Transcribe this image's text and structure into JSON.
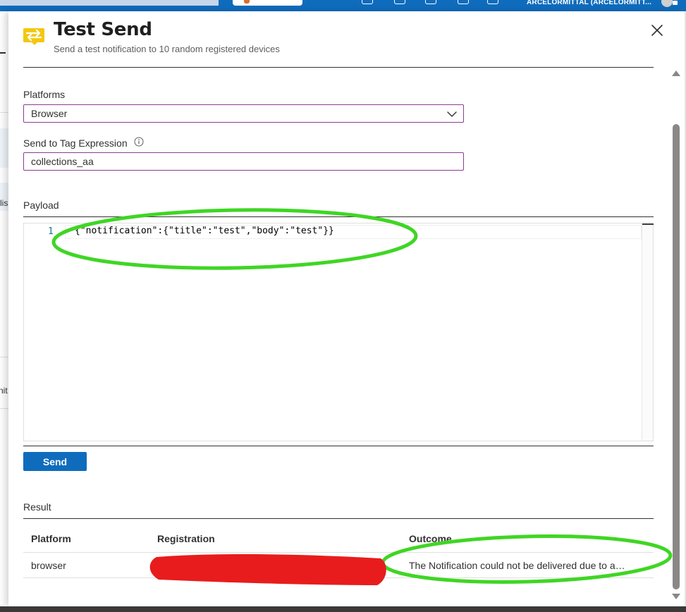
{
  "topbar": {
    "account": "ARCELORMITTAL (ARCELORMITT..."
  },
  "background": {
    "fragments": [
      "lis",
      "nit"
    ]
  },
  "header": {
    "title": "Test Send",
    "subtitle": "Send a test notification to 10 random registered devices",
    "icon": "notification-hub-icon"
  },
  "form": {
    "platforms_label": "Platforms",
    "platform_value": "Browser",
    "tag_label": "Send to Tag Expression",
    "tag_value": "collections_aa",
    "payload_label": "Payload",
    "payload_line_number": "1",
    "payload_code": "{\"notification\":{\"title\":\"test\",\"body\":\"test\"}}",
    "send_label": "Send"
  },
  "result": {
    "label": "Result",
    "columns": [
      "Platform",
      "Registration",
      "Outcome"
    ],
    "rows": [
      {
        "platform": "browser",
        "registration": "",
        "outcome": "The Notification could not be delivered due to an unknown error."
      }
    ]
  },
  "colors": {
    "accent": "#0f6cbd",
    "input_border": "#8a3d8f",
    "annotation_green": "#3fd624",
    "redaction_red": "#e81c1c"
  }
}
